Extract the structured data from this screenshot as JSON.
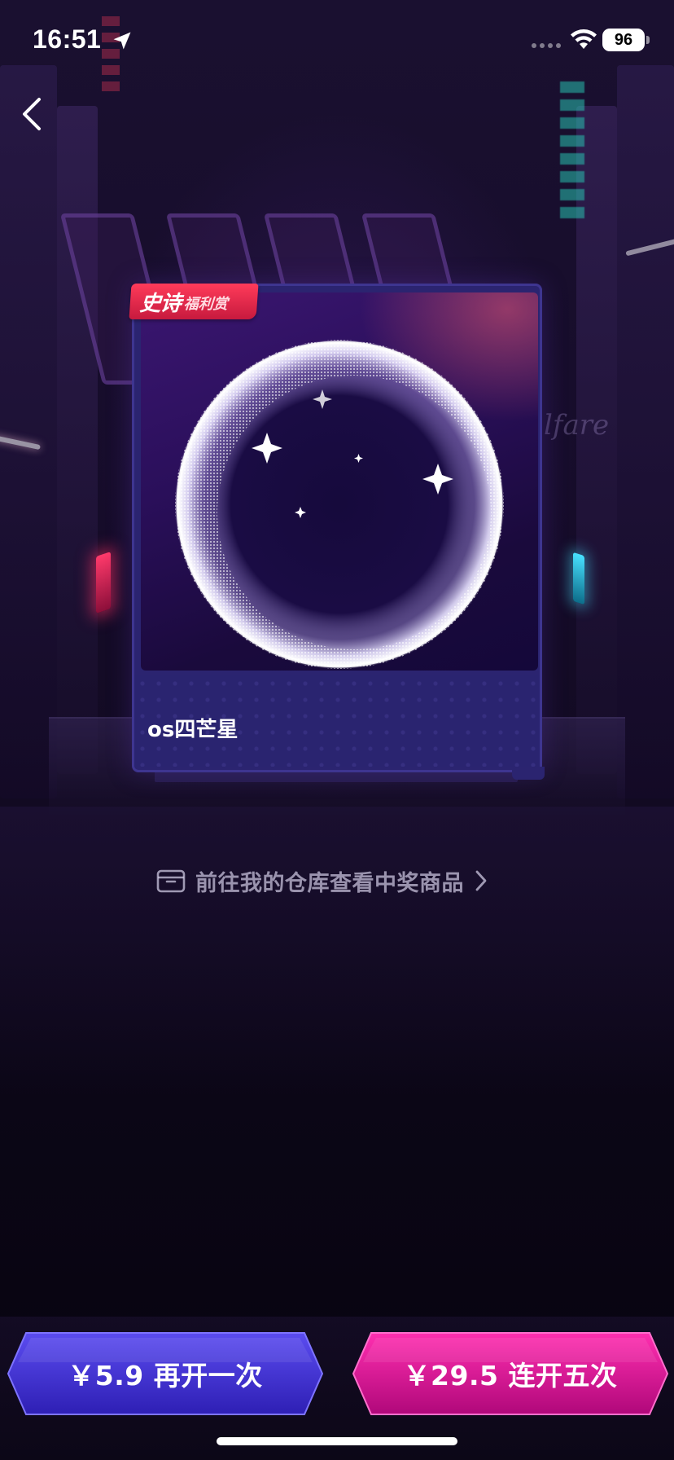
{
  "status_bar": {
    "time": "16:51",
    "battery": "96",
    "icons": [
      "location-arrow-icon",
      "cellular-signal-icon",
      "wifi-icon",
      "battery-icon"
    ]
  },
  "nav": {
    "back_icon": "chevron-left-icon"
  },
  "prize": {
    "badge_main": "史诗",
    "badge_sub": "福利赏",
    "name": "os四芒星",
    "image_icon": "planet-sphere-image"
  },
  "warehouse_link": {
    "icon": "box-icon",
    "label": "前往我的仓库查看中奖商品",
    "chevron_icon": "chevron-right-icon"
  },
  "actions": {
    "open_once": "￥5.9 再开一次",
    "open_five": "￥29.5 连开五次"
  },
  "colors": {
    "background": "#0b0619",
    "open_once_button": "#3d2fd0",
    "open_five_button": "#d6138c",
    "badge": "#e8264c"
  }
}
